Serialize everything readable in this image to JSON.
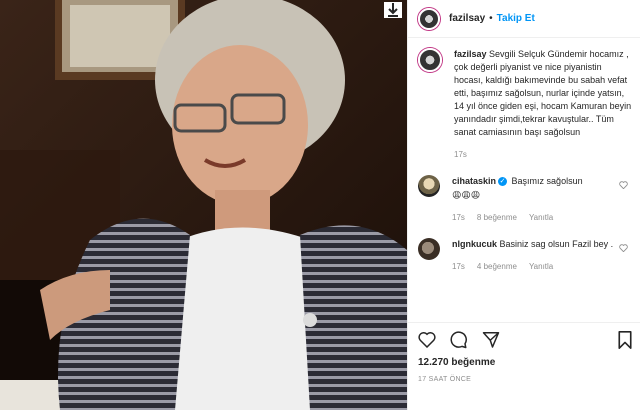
{
  "post": {
    "username": "fazilsay",
    "follow_label": "Takip Et",
    "caption": "Sevgili Selçuk Gündemir hocamız , çok değerli piyanist ve nice piyanistin hocası, kaldığı bakımevinde bu sabah vefat etti, başımız sağolsun, nurlar içinde yatsın, 14 yıl önce giden eşi, hocam Kamuran beyin yanındadır şimdi,tekrar kavuştular.. Tüm sanat camiasının başı sağolsun",
    "caption_time": "17s",
    "likes": "12.270 beğenme",
    "time_ago": "17 SAAT ÖNCE"
  },
  "comments": [
    {
      "username": "cihataskin",
      "text": "Başımız sağolsun",
      "text2": "😩😩😩",
      "time": "17s",
      "likes": "8 beğenme",
      "reply": "Yanıtla"
    },
    {
      "username": "nlgnkucuk",
      "text": "Basiniz sag olsun Fazil bey .",
      "time": "17s",
      "likes": "4 beğenme",
      "reply": "Yanıtla"
    }
  ],
  "icons": [
    "download-icon",
    "heart-icon",
    "comment-icon",
    "share-icon",
    "bookmark-icon",
    "verified-icon"
  ],
  "colors": {
    "follow": "#0095f6",
    "meta": "#8e8e8e",
    "text": "#262626"
  }
}
